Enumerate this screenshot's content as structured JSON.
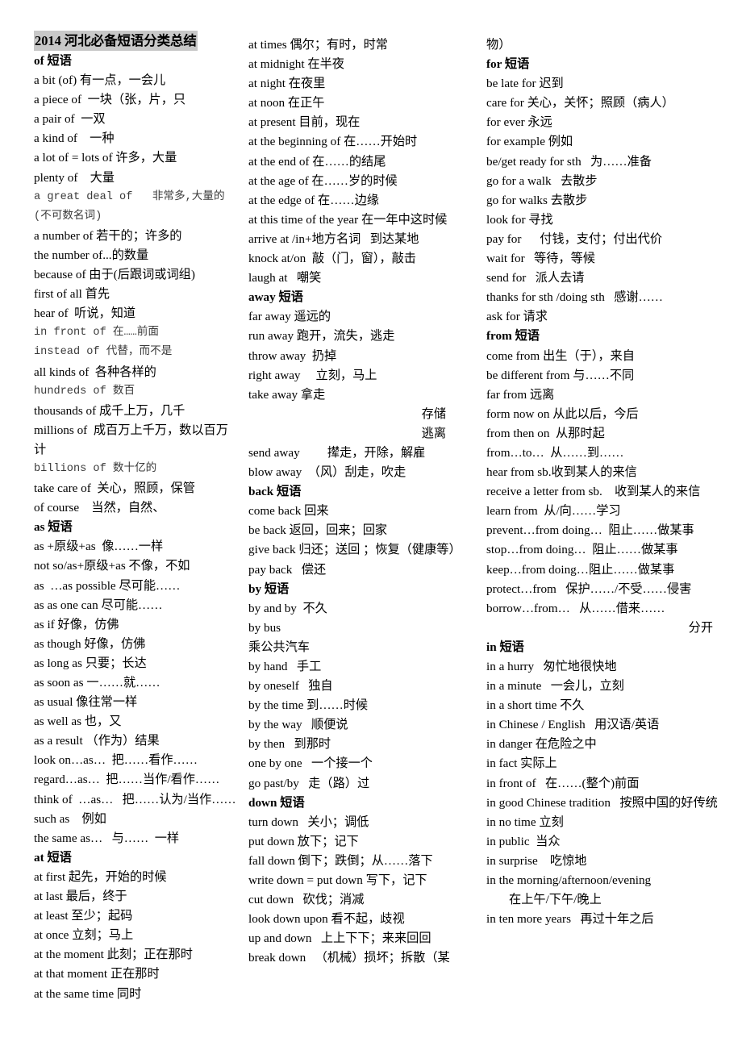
{
  "document": {
    "title": "2014 河北必备短语分类总结",
    "title_highlight_color": "#c8c8c8",
    "page_background": "#ffffff",
    "text_color": "#000000"
  },
  "columns": [
    {
      "id": "column-1",
      "lines": [
        {
          "t": "of 短语",
          "style": "header"
        },
        {
          "t": "a bit (of) 有一点，一会儿",
          "style": "normal"
        },
        {
          "t": "a piece of  一块（张，片，只",
          "style": "normal"
        },
        {
          "t": "a pair of  一双",
          "style": "normal"
        },
        {
          "t": "a kind of    一种",
          "style": "normal"
        },
        {
          "t": "a lot of = lots of 许多，大量",
          "style": "normal"
        },
        {
          "t": "plenty of    大量",
          "style": "normal"
        },
        {
          "t": "a great deal of   非常多,大量的(不可数名词)",
          "style": "mono"
        },
        {
          "t": "a number of 若干的；许多的",
          "style": "normal"
        },
        {
          "t": "the number of...的数量",
          "style": "normal"
        },
        {
          "t": "because of 由于(后跟词或词组)",
          "style": "normal"
        },
        {
          "t": "first of all 首先",
          "style": "normal"
        },
        {
          "t": "hear of  听说，知道",
          "style": "normal"
        },
        {
          "t": "in front of 在……前面",
          "style": "mono"
        },
        {
          "t": "instead of 代替，而不是",
          "style": "mono"
        },
        {
          "t": "all kinds of  各种各样的",
          "style": "normal"
        },
        {
          "t": "hundreds of 数百",
          "style": "mono"
        },
        {
          "t": "thousands of 成千上万，几千",
          "style": "normal"
        },
        {
          "t": "millions of  成百万上千万，数以百万计",
          "style": "normal"
        },
        {
          "t": "billions of 数十亿的",
          "style": "mono"
        },
        {
          "t": "take care of  关心，照顾，保管",
          "style": "normal"
        },
        {
          "t": "of course    当然，自然、",
          "style": "normal"
        },
        {
          "t": "as 短语",
          "style": "header"
        },
        {
          "t": "as +原级+as  像……一样",
          "style": "normal"
        },
        {
          "t": "not so/as+原级+as 不像，不如",
          "style": "normal"
        },
        {
          "t": "as  …as possible 尽可能……",
          "style": "normal"
        },
        {
          "t": "as as one can 尽可能……",
          "style": "normal"
        },
        {
          "t": "as if 好像，仿佛",
          "style": "normal"
        },
        {
          "t": "as though 好像，仿佛",
          "style": "normal"
        },
        {
          "t": "as long as 只要；长达",
          "style": "normal"
        },
        {
          "t": "as soon as 一……就……",
          "style": "normal"
        },
        {
          "t": "as usual 像往常一样",
          "style": "normal"
        },
        {
          "t": "as well as 也，又",
          "style": "normal"
        },
        {
          "t": "as a result （作为）结果",
          "style": "normal"
        },
        {
          "t": "look on…as…  把……看作……",
          "style": "normal"
        },
        {
          "t": "regard…as…  把……当作/看作……",
          "style": "normal"
        },
        {
          "t": "think of  …as…   把……认为/当作……",
          "style": "normal"
        },
        {
          "t": "such as    例如",
          "style": "normal"
        },
        {
          "t": "the same as…   与……  一样",
          "style": "normal"
        },
        {
          "t": "at 短语",
          "style": "header"
        },
        {
          "t": "at first 起先，开始的时候",
          "style": "normal"
        },
        {
          "t": "at last 最后，终于",
          "style": "normal"
        },
        {
          "t": "at least 至少；起码",
          "style": "normal"
        },
        {
          "t": "at once 立刻；马上",
          "style": "normal"
        },
        {
          "t": "at the moment 此刻；正在那时",
          "style": "normal"
        },
        {
          "t": "at that moment 正在那时",
          "style": "normal"
        },
        {
          "t": "at the same time 同时",
          "style": "normal"
        }
      ]
    },
    {
      "id": "column-2",
      "lines": [
        {
          "t": "at times 偶尔；有时，时常",
          "style": "normal"
        },
        {
          "t": "at midnight 在半夜",
          "style": "normal"
        },
        {
          "t": "at night 在夜里",
          "style": "normal"
        },
        {
          "t": "at noon 在正午",
          "style": "normal"
        },
        {
          "t": "at present 目前，现在",
          "style": "normal"
        },
        {
          "t": "at the beginning of 在……开始时",
          "style": "normal"
        },
        {
          "t": "at the end of 在……的结尾",
          "style": "normal"
        },
        {
          "t": "at the age of 在……岁的时候",
          "style": "normal"
        },
        {
          "t": "at the edge of 在……边缘",
          "style": "normal"
        },
        {
          "t": "at this time of the year 在一年中这时候",
          "style": "normal"
        },
        {
          "t": "arrive at /in+地方名词   到达某地",
          "style": "normal"
        },
        {
          "t": "knock at/on  敲（门，窗），敲击",
          "style": "normal"
        },
        {
          "t": "laugh at   嘲笑",
          "style": "normal"
        },
        {
          "t": "away 短语",
          "style": "header"
        },
        {
          "t": "far away 遥远的",
          "style": "normal"
        },
        {
          "t": "run away 跑开，流失，逃走",
          "style": "normal"
        },
        {
          "t": "throw away  扔掉",
          "style": "normal"
        },
        {
          "t": "right away     立刻，马上",
          "style": "normal"
        },
        {
          "t": "take away 拿走",
          "style": "normal"
        },
        {
          "t": "存储",
          "style": "right-indent"
        },
        {
          "t": "逃离",
          "style": "right-indent"
        },
        {
          "t": "send away         撵走，开除，解雇",
          "style": "normal"
        },
        {
          "t": "blow away  （风）刮走，吹走",
          "style": "normal"
        },
        {
          "t": "back 短语",
          "style": "header"
        },
        {
          "t": "come back 回来",
          "style": "normal"
        },
        {
          "t": "be back 返回，回来；回家",
          "style": "normal"
        },
        {
          "t": "give back 归还；送回 ；恢复（健康等）",
          "style": "normal"
        },
        {
          "t": "pay back   偿还",
          "style": "normal"
        },
        {
          "t": "by 短语",
          "style": "header"
        },
        {
          "t": "by and by  不久",
          "style": "normal"
        },
        {
          "t": "by bus",
          "style": "normal"
        },
        {
          "t": "乘公共汽车",
          "style": "normal"
        },
        {
          "t": "by hand   手工",
          "style": "normal"
        },
        {
          "t": "by oneself   独自",
          "style": "normal"
        },
        {
          "t": "by the time 到……时候",
          "style": "normal"
        },
        {
          "t": "by the way   顺便说",
          "style": "normal"
        },
        {
          "t": "by then   到那时",
          "style": "normal"
        },
        {
          "t": "one by one   一个接一个",
          "style": "normal"
        },
        {
          "t": "go past/by   走（路）过",
          "style": "normal"
        },
        {
          "t": "down 短语",
          "style": "header"
        },
        {
          "t": "turn down   关小；调低",
          "style": "normal"
        },
        {
          "t": "put down 放下；记下",
          "style": "normal"
        },
        {
          "t": "fall down 倒下；跌倒；从……落下",
          "style": "normal"
        },
        {
          "t": "write down = put down 写下，记下",
          "style": "normal"
        },
        {
          "t": "cut down   砍伐；消减",
          "style": "normal"
        },
        {
          "t": "look down upon 看不起，歧视",
          "style": "normal"
        },
        {
          "t": "up and down   上上下下；来来回回",
          "style": "normal"
        },
        {
          "t": "break down   （机械）损坏；拆散（某",
          "style": "normal"
        }
      ]
    },
    {
      "id": "column-3",
      "lines": [
        {
          "t": "物）",
          "style": "normal"
        },
        {
          "t": "for 短语",
          "style": "header"
        },
        {
          "t": "be late for 迟到",
          "style": "normal"
        },
        {
          "t": "care for 关心，关怀；照顾（病人）",
          "style": "normal"
        },
        {
          "t": "for ever 永远",
          "style": "normal"
        },
        {
          "t": "for example 例如",
          "style": "normal"
        },
        {
          "t": "be/get ready for sth   为……准备",
          "style": "normal"
        },
        {
          "t": "go for a walk   去散步",
          "style": "normal"
        },
        {
          "t": "go for walks 去散步",
          "style": "normal"
        },
        {
          "t": "look for 寻找",
          "style": "normal"
        },
        {
          "t": "pay for      付钱，支付；付出代价",
          "style": "normal"
        },
        {
          "t": "wait for   等待，等候",
          "style": "normal"
        },
        {
          "t": "send for   派人去请",
          "style": "normal"
        },
        {
          "t": "thanks for sth /doing sth   感谢……",
          "style": "normal"
        },
        {
          "t": "ask for 请求",
          "style": "normal"
        },
        {
          "t": "from 短语",
          "style": "header"
        },
        {
          "t": "come from 出生（于），来自",
          "style": "normal"
        },
        {
          "t": "be different from 与……不同",
          "style": "normal"
        },
        {
          "t": "far from 远离",
          "style": "normal"
        },
        {
          "t": "form now on 从此以后，今后",
          "style": "normal"
        },
        {
          "t": "from then on  从那时起",
          "style": "normal"
        },
        {
          "t": "from…to…  从……到……",
          "style": "normal"
        },
        {
          "t": "hear from sb.收到某人的来信",
          "style": "normal"
        },
        {
          "t": "receive a letter from sb.    收到某人的来信",
          "style": "normal"
        },
        {
          "t": "learn from  从/向……学习",
          "style": "normal"
        },
        {
          "t": "prevent…from doing…  阻止……做某事",
          "style": "normal"
        },
        {
          "t": "stop…from doing…  阻止……做某事",
          "style": "normal"
        },
        {
          "t": "keep…from doing…阻止……做某事",
          "style": "normal"
        },
        {
          "t": "protect…from   保护……/不受……侵害",
          "style": "normal"
        },
        {
          "t": "borrow…from…   从……借来……",
          "style": "normal"
        },
        {
          "t": "分开",
          "style": "right-indent-2"
        },
        {
          "t": "in 短语",
          "style": "header"
        },
        {
          "t": "in a hurry   匆忙地很快地",
          "style": "normal"
        },
        {
          "t": "in a minute   一会儿，立刻",
          "style": "normal"
        },
        {
          "t": "in a short time 不久",
          "style": "normal"
        },
        {
          "t": "in Chinese / English   用汉语/英语",
          "style": "normal"
        },
        {
          "t": "in danger 在危险之中",
          "style": "normal"
        },
        {
          "t": "in fact 实际上",
          "style": "normal"
        },
        {
          "t": "in front of   在……(整个)前面",
          "style": "normal"
        },
        {
          "t": "in good Chinese tradition   按照中国的好传统",
          "style": "normal"
        },
        {
          "t": "in no time 立刻",
          "style": "normal"
        },
        {
          "t": "in public  当众",
          "style": "normal"
        },
        {
          "t": "in surprise    吃惊地",
          "style": "normal"
        },
        {
          "t": "in the morning/afternoon/evening",
          "style": "normal"
        },
        {
          "t": "在上午/下午/晚上",
          "style": "left-indent"
        },
        {
          "t": "in ten more years   再过十年之后",
          "style": "normal"
        }
      ]
    }
  ]
}
